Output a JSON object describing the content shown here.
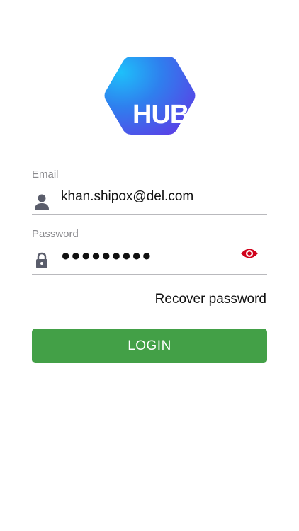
{
  "logo": {
    "text": "HUB",
    "gradient_start": "#1ea6f4",
    "gradient_end": "#5b3fe6"
  },
  "email": {
    "label": "Email",
    "value": "khan.shipox@del.com",
    "icon": "person-icon"
  },
  "password": {
    "label": "Password",
    "masked_value": "●●●●●●●●●",
    "icon": "lock-icon",
    "toggle_icon": "eye-icon",
    "toggle_color": "#d0021b"
  },
  "recover": {
    "label": "Recover password"
  },
  "login": {
    "label": "LOGIN",
    "color": "#43a047"
  }
}
